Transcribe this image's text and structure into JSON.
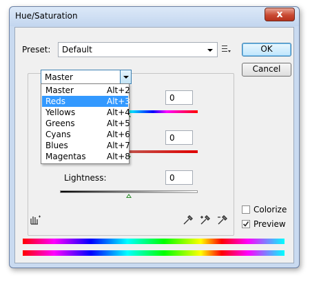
{
  "window": {
    "title": "Hue/Saturation",
    "close_glyph": "x"
  },
  "preset": {
    "label": "Preset:",
    "value": "Default",
    "options_icon": "preset-options-icon"
  },
  "buttons": {
    "ok": "OK",
    "cancel": "Cancel"
  },
  "channel": {
    "selected": "Master",
    "menu": [
      {
        "name": "Master",
        "shortcut": "Alt+2",
        "highlighted": false
      },
      {
        "name": "Reds",
        "shortcut": "Alt+3",
        "highlighted": true
      },
      {
        "name": "Yellows",
        "shortcut": "Alt+4",
        "highlighted": false
      },
      {
        "name": "Greens",
        "shortcut": "Alt+5",
        "highlighted": false
      },
      {
        "name": "Cyans",
        "shortcut": "Alt+6",
        "highlighted": false
      },
      {
        "name": "Blues",
        "shortcut": "Alt+7",
        "highlighted": false
      },
      {
        "name": "Magentas",
        "shortcut": "Alt+8",
        "highlighted": false
      }
    ]
  },
  "adjustments": {
    "hue": {
      "value": "0"
    },
    "saturation": {
      "value": "0"
    },
    "lightness": {
      "label": "Lightness:",
      "value": "0"
    }
  },
  "options": {
    "colorize": {
      "label": "Colorize",
      "checked": false
    },
    "preview": {
      "label": "Preview",
      "checked": true
    }
  },
  "icons": [
    "on-image-adjust-icon",
    "eyedropper-icon",
    "eyedropper-plus-icon",
    "eyedropper-minus-icon"
  ],
  "colors": {
    "selection": "#3399ff",
    "close": "#c94a33",
    "slider_handle": "#2e8b2e"
  }
}
